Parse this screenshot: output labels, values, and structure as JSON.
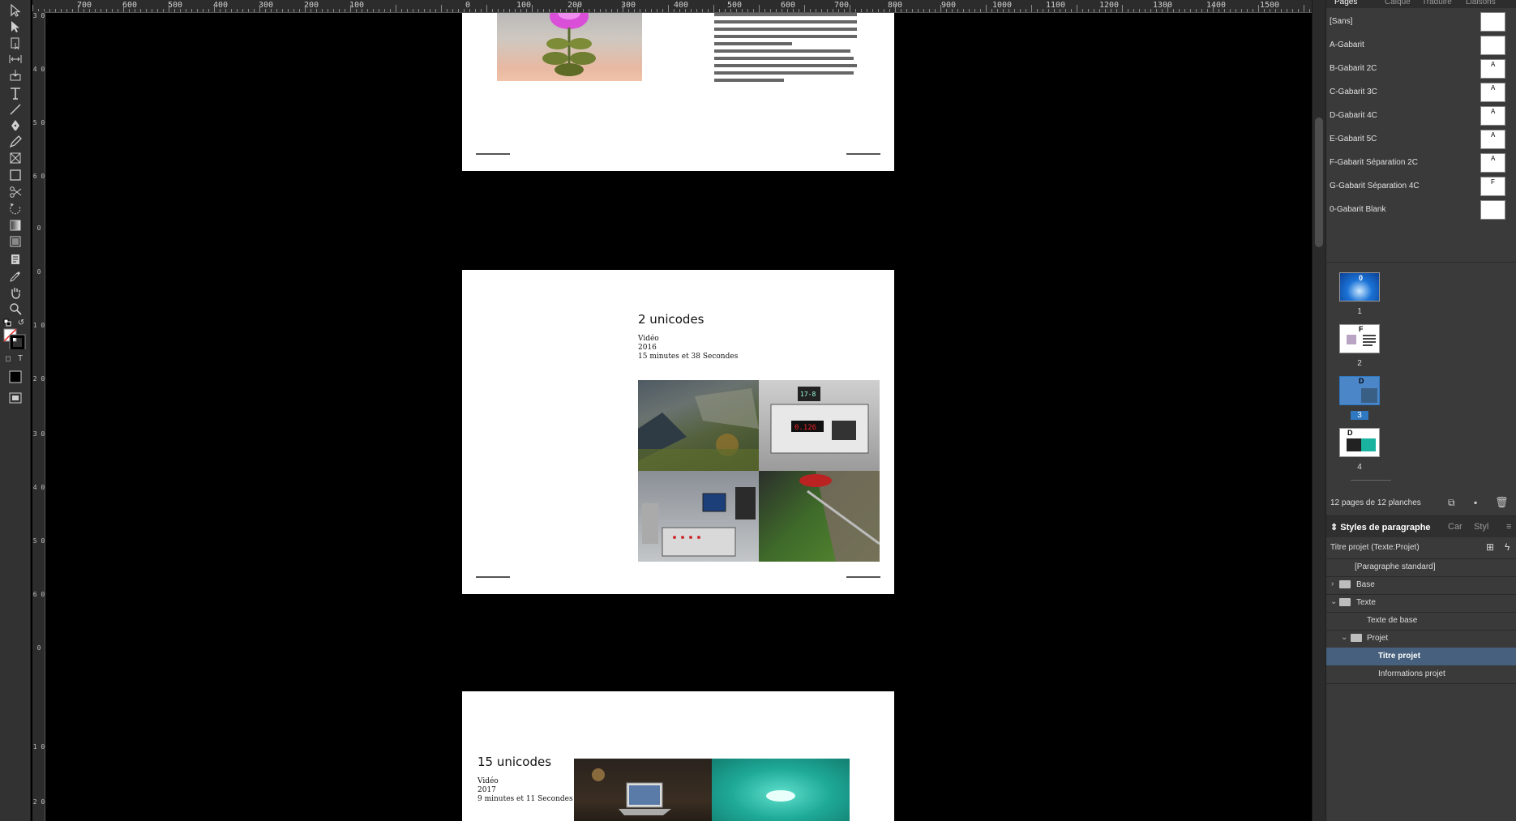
{
  "hruler": {
    "labels": [
      "700",
      "600",
      "500",
      "400",
      "300",
      "200",
      "100",
      "0",
      "100",
      "200",
      "300",
      "400",
      "500",
      "600",
      "700",
      "800",
      "900",
      "1000",
      "1100",
      "1200",
      "1300",
      "1400",
      "1500"
    ]
  },
  "vruler": {
    "labels": [
      "3 0",
      "4 0",
      "5 0",
      "6 0",
      "0",
      "0",
      "1 0",
      "2 0",
      "3 0",
      "4 0",
      "5 0",
      "6 0",
      "0",
      "1 0",
      "2 0"
    ]
  },
  "project2": {
    "title": "2 unicodes",
    "info": [
      "Vidéo",
      "2016",
      "15 minutes et 38 Secondes"
    ]
  },
  "project3": {
    "title": "15 unicodes",
    "info": [
      "Vidéo",
      "2017",
      "9 minutes et 11 Secondes"
    ]
  },
  "pages_panel": {
    "tabs": [
      "Pages",
      "Calque",
      "Traduire",
      "Liaisons"
    ],
    "masters": [
      {
        "label": "[Sans]",
        "prefix": ""
      },
      {
        "label": "A-Gabarit",
        "prefix": ""
      },
      {
        "label": "B-Gabarit 2C",
        "prefix": "A"
      },
      {
        "label": "C-Gabarit 3C",
        "prefix": "A"
      },
      {
        "label": "D-Gabarit 4C",
        "prefix": "A"
      },
      {
        "label": "E-Gabarit 5C",
        "prefix": "A"
      },
      {
        "label": "F-Gabarit Séparation 2C",
        "prefix": "A"
      },
      {
        "label": "G-Gabarit Séparation 4C",
        "prefix": "F"
      },
      {
        "label": "0-Gabarit Blank",
        "prefix": ""
      }
    ],
    "pages": [
      {
        "num": "1",
        "master": "0"
      },
      {
        "num": "2",
        "master": "F"
      },
      {
        "num": "3",
        "master": "D"
      },
      {
        "num": "4",
        "master": "D"
      }
    ],
    "summary": "12 pages de 12 planches"
  },
  "styles_panel": {
    "tabs": [
      "Styles de paragraphe",
      "Car",
      "Styl"
    ],
    "current": "Titre projet (Texte:Projet)",
    "items": [
      {
        "label": "[Paragraphe standard]",
        "kind": "style"
      },
      {
        "label": "Base",
        "kind": "folder"
      },
      {
        "label": "Texte",
        "kind": "folder"
      },
      {
        "label": "Texte de base",
        "kind": "style"
      },
      {
        "label": "Projet",
        "kind": "folder"
      },
      {
        "label": "Titre projet",
        "kind": "style"
      },
      {
        "label": "Informations projet",
        "kind": "style"
      }
    ]
  },
  "colors": {
    "panel_bg": "#3a3a3a",
    "selection": "#46607d",
    "page_selection": "#2f78c2"
  }
}
